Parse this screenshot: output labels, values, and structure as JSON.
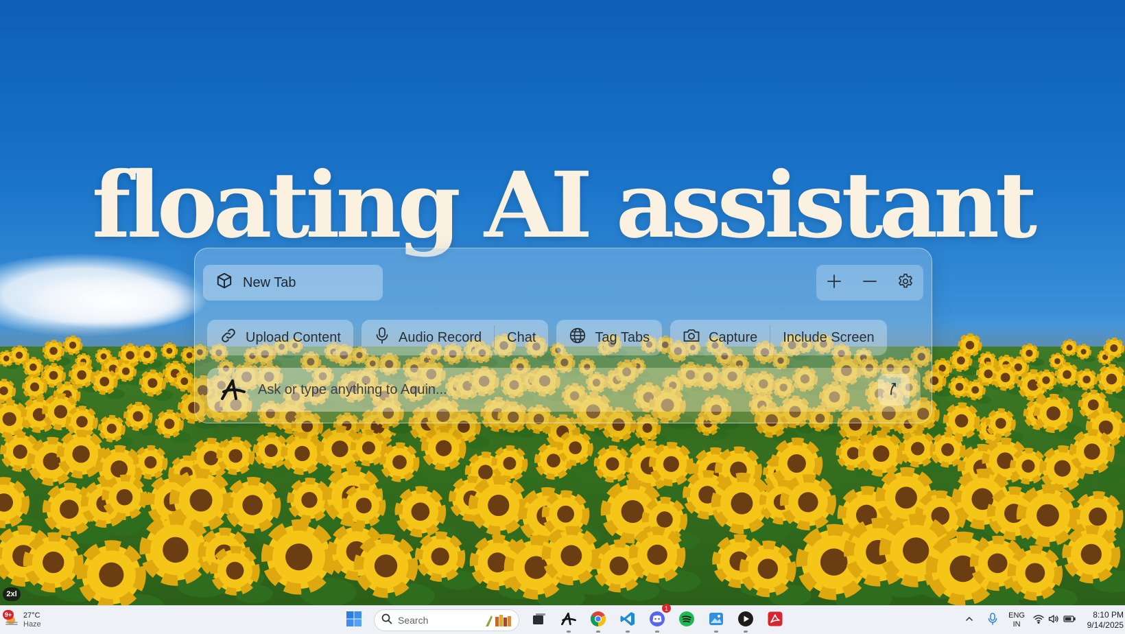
{
  "headline": "floating AI assistant",
  "panel": {
    "tab": {
      "label": "New Tab",
      "icon": "cube-icon"
    },
    "controls": [
      {
        "name": "add-tab-button",
        "icon": "plus-icon"
      },
      {
        "name": "minimize-button",
        "icon": "minus-icon"
      },
      {
        "name": "settings-button",
        "icon": "gear-icon"
      }
    ],
    "actions": {
      "upload": {
        "label": "Upload Content",
        "icon": "link-icon"
      },
      "audio_record": {
        "label": "Audio Record",
        "icon": "microphone-icon"
      },
      "chat": {
        "label": "Chat"
      },
      "tag_tabs": {
        "label": "Tag Tabs",
        "icon": "globe-icon"
      },
      "capture": {
        "label": "Capture",
        "icon": "camera-icon"
      },
      "include_screen": {
        "label": "Include Screen"
      }
    },
    "input": {
      "placeholder": "Ask or type anything to Aquin...",
      "value": ""
    }
  },
  "zoom_badge": "2xl",
  "taskbar": {
    "weather": {
      "temp": "27°C",
      "condition": "Haze",
      "badge": "9+"
    },
    "search_placeholder": "Search",
    "apps": [
      "windows-start-icon",
      "task-view-icon",
      "aquin-icon",
      "chrome-icon",
      "vscode-icon",
      "discord-icon",
      "spotify-icon",
      "photos-icon",
      "media-player-icon",
      "acrobat-icon"
    ],
    "discord_badge": "1",
    "language": {
      "line1": "ENG",
      "line2": "IN"
    },
    "clock": {
      "time": "8:10 PM",
      "date": "9/14/2025"
    }
  },
  "colors": {
    "headline": "#fbf1e1",
    "sky_top": "#0d5fb5",
    "sunflower_petal": "#f5c518",
    "sunflower_center": "#6b3d12",
    "taskbar_bg": "#eef1f6"
  }
}
